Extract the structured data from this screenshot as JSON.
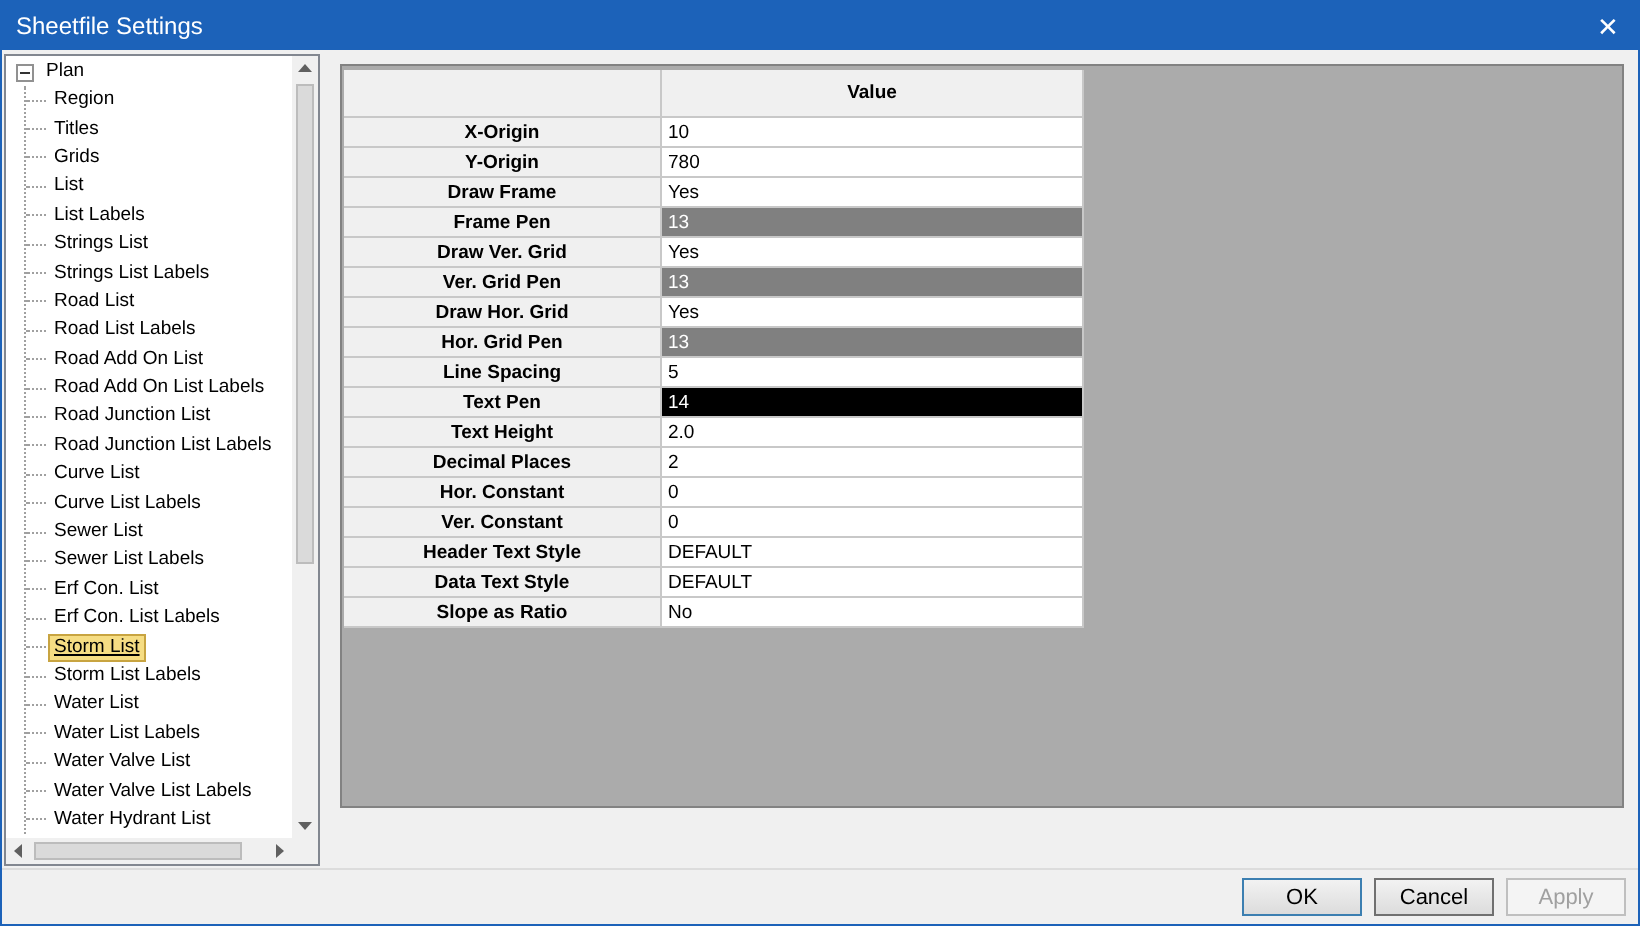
{
  "window": {
    "title": "Sheetfile Settings",
    "close": "✕"
  },
  "tree": {
    "label": "Plan",
    "expanded": true,
    "children": [
      {
        "label": "Region",
        "selected": false
      },
      {
        "label": "Titles",
        "selected": false
      },
      {
        "label": "Grids",
        "selected": false
      },
      {
        "label": "List",
        "selected": false
      },
      {
        "label": "List Labels",
        "selected": false
      },
      {
        "label": "Strings List",
        "selected": false
      },
      {
        "label": "Strings List Labels",
        "selected": false
      },
      {
        "label": "Road List",
        "selected": false
      },
      {
        "label": "Road List Labels",
        "selected": false
      },
      {
        "label": "Road Add On List",
        "selected": false
      },
      {
        "label": "Road Add On List Labels",
        "selected": false
      },
      {
        "label": "Road Junction List",
        "selected": false
      },
      {
        "label": "Road Junction List Labels",
        "selected": false
      },
      {
        "label": "Curve List",
        "selected": false
      },
      {
        "label": "Curve List Labels",
        "selected": false
      },
      {
        "label": "Sewer List",
        "selected": false
      },
      {
        "label": "Sewer List Labels",
        "selected": false
      },
      {
        "label": "Erf Con. List",
        "selected": false
      },
      {
        "label": "Erf Con. List Labels",
        "selected": false
      },
      {
        "label": "Storm List",
        "selected": true
      },
      {
        "label": "Storm List Labels",
        "selected": false
      },
      {
        "label": "Water List",
        "selected": false
      },
      {
        "label": "Water List Labels",
        "selected": false
      },
      {
        "label": "Water Valve List",
        "selected": false
      },
      {
        "label": "Water Valve List Labels",
        "selected": false
      },
      {
        "label": "Water Hydrant List",
        "selected": false
      }
    ]
  },
  "table": {
    "columns": [
      "Value"
    ],
    "rows": [
      {
        "name": "X-Origin",
        "value": "10"
      },
      {
        "name": "Y-Origin",
        "value": "780"
      },
      {
        "name": "Draw Frame",
        "value": "Yes"
      },
      {
        "name": "Frame Pen",
        "value": "13",
        "color": "#808080"
      },
      {
        "name": "Draw Ver. Grid",
        "value": "Yes"
      },
      {
        "name": "Ver. Grid Pen",
        "value": "13",
        "color": "#808080"
      },
      {
        "name": "Draw Hor. Grid",
        "value": "Yes"
      },
      {
        "name": "Hor. Grid Pen",
        "value": "13",
        "color": "#808080"
      },
      {
        "name": "Line Spacing",
        "value": "5"
      },
      {
        "name": "Text Pen",
        "value": "14",
        "color": "#000000"
      },
      {
        "name": "Text Height",
        "value": "2.0"
      },
      {
        "name": "Decimal Places",
        "value": "2"
      },
      {
        "name": "Hor. Constant",
        "value": "0"
      },
      {
        "name": "Ver. Constant",
        "value": "0"
      },
      {
        "name": "Header Text Style",
        "value": "DEFAULT"
      },
      {
        "name": "Data Text Style",
        "value": "DEFAULT"
      },
      {
        "name": "Slope as Ratio",
        "value": "No"
      }
    ]
  },
  "buttons": [
    {
      "label": "OK",
      "disabled": false
    },
    {
      "label": "Cancel",
      "disabled": false
    },
    {
      "label": "Apply",
      "disabled": true
    }
  ]
}
